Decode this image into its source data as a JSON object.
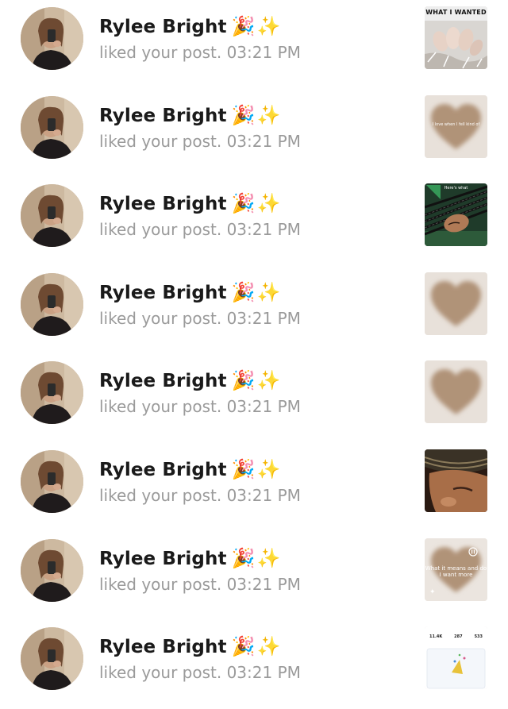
{
  "notifications": [
    {
      "name": "Rylee Bright",
      "emojis": [
        "🎉",
        "✨"
      ],
      "message": "liked your post.",
      "time": "03:21 PM",
      "thumb_type": "nails",
      "caption": "WHAT I WANTED"
    },
    {
      "name": "Rylee Bright",
      "emojis": [
        "🎉",
        "✨"
      ],
      "message": "liked your post.",
      "time": "03:21 PM",
      "thumb_type": "heart-text",
      "caption": "I love when I fell kind of"
    },
    {
      "name": "Rylee Bright",
      "emojis": [
        "🎉",
        "✨"
      ],
      "message": "liked your post.",
      "time": "03:21 PM",
      "thumb_type": "braids",
      "caption": "Here's what"
    },
    {
      "name": "Rylee Bright",
      "emojis": [
        "🎉",
        "✨"
      ],
      "message": "liked your post.",
      "time": "03:21 PM",
      "thumb_type": "heart",
      "caption": ""
    },
    {
      "name": "Rylee Bright",
      "emojis": [
        "🎉",
        "✨"
      ],
      "message": "liked your post.",
      "time": "03:21 PM",
      "thumb_type": "heart",
      "caption": ""
    },
    {
      "name": "Rylee Bright",
      "emojis": [
        "🎉",
        "✨"
      ],
      "message": "liked your post.",
      "time": "03:21 PM",
      "thumb_type": "headwrap",
      "caption": ""
    },
    {
      "name": "Rylee Bright",
      "emojis": [
        "🎉",
        "✨"
      ],
      "message": "liked your post.",
      "time": "03:21 PM",
      "thumb_type": "heart-quote",
      "caption": "What it means and do I want more"
    },
    {
      "name": "Rylee Bright",
      "emojis": [
        "🎉",
        "✨"
      ],
      "message": "liked your post.",
      "time": "03:21 PM",
      "thumb_type": "stats",
      "caption": "",
      "stats": [
        "11.4K",
        "287",
        "533"
      ]
    }
  ],
  "colors": {
    "name": "#1a1a1a",
    "subtext": "#9a9a9a",
    "heart": "#b09378",
    "background": "#ffffff"
  }
}
